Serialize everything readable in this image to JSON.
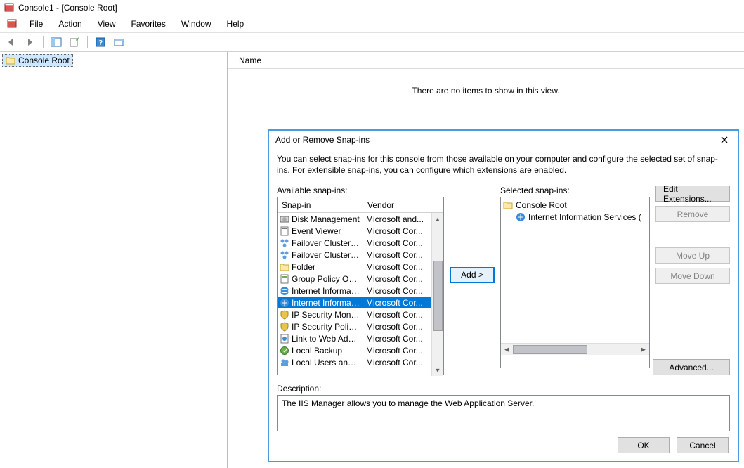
{
  "window": {
    "title": "Console1 - [Console Root]"
  },
  "menu": {
    "file": "File",
    "action": "Action",
    "view": "View",
    "favorites": "Favorites",
    "window": "Window",
    "help": "Help"
  },
  "tree": {
    "root": "Console Root"
  },
  "list": {
    "col_name": "Name",
    "empty": "There are no items to show in this view."
  },
  "dialog": {
    "title": "Add or Remove Snap-ins",
    "intro": "You can select snap-ins for this console from those available on your computer and configure the selected set of snap-ins. For extensible snap-ins, you can configure which extensions are enabled.",
    "available_label": "Available snap-ins:",
    "selected_label": "Selected snap-ins:",
    "col_snapin": "Snap-in",
    "col_vendor": "Vendor",
    "add": "Add >",
    "edit_ext": "Edit Extensions...",
    "remove": "Remove",
    "moveup": "Move Up",
    "movedown": "Move Down",
    "advanced": "Advanced...",
    "desc_label": "Description:",
    "desc_text": "The IIS Manager allows you to manage the Web Application Server.",
    "ok": "OK",
    "cancel": "Cancel"
  },
  "available": [
    {
      "name": "Disk Management",
      "vendor": "Microsoft and...",
      "icon": "disk"
    },
    {
      "name": "Event Viewer",
      "vendor": "Microsoft Cor...",
      "icon": "event"
    },
    {
      "name": "Failover Cluster Man...",
      "vendor": "Microsoft Cor...",
      "icon": "cluster"
    },
    {
      "name": "Failover Cluster Man...",
      "vendor": "Microsoft Cor...",
      "icon": "cluster"
    },
    {
      "name": "Folder",
      "vendor": "Microsoft Cor...",
      "icon": "folder"
    },
    {
      "name": "Group Policy Object ...",
      "vendor": "Microsoft Cor...",
      "icon": "gpo"
    },
    {
      "name": "Internet Informatio...",
      "vendor": "Microsoft Cor...",
      "icon": "iis6"
    },
    {
      "name": "Internet Informatio...",
      "vendor": "Microsoft Cor...",
      "icon": "iis",
      "selected": true
    },
    {
      "name": "IP Security Monitor",
      "vendor": "Microsoft Cor...",
      "icon": "ipsec"
    },
    {
      "name": "IP Security Policy M...",
      "vendor": "Microsoft Cor...",
      "icon": "ipsec"
    },
    {
      "name": "Link to Web Address",
      "vendor": "Microsoft Cor...",
      "icon": "link"
    },
    {
      "name": "Local Backup",
      "vendor": "Microsoft Cor...",
      "icon": "backup"
    },
    {
      "name": "Local Users and Gro...",
      "vendor": "Microsoft Cor...",
      "icon": "users"
    }
  ],
  "selected": {
    "root": "Console Root",
    "items": [
      "Internet Information Services ("
    ]
  }
}
